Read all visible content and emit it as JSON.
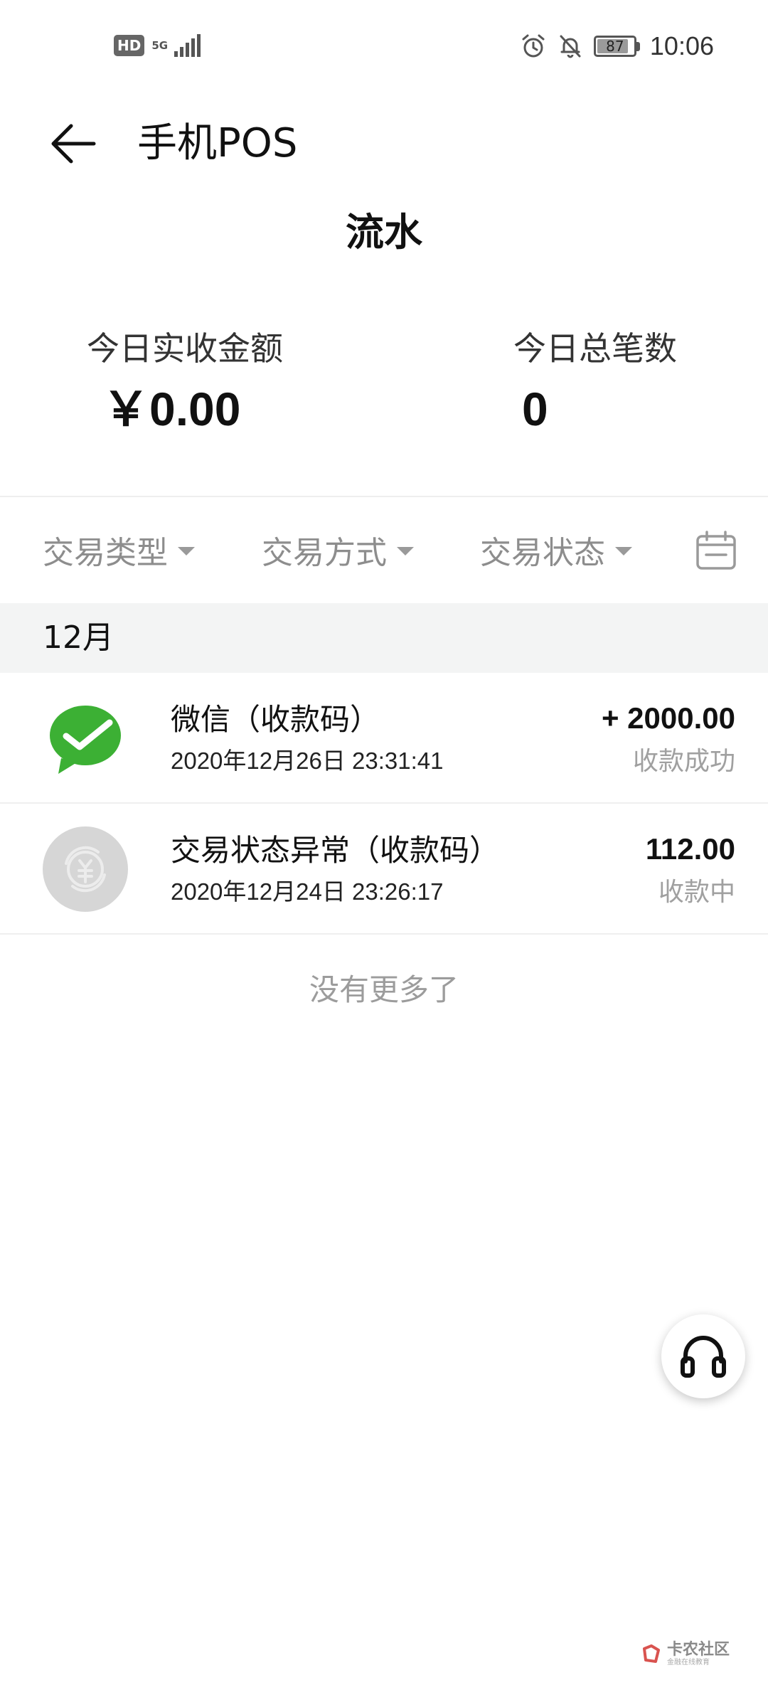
{
  "status_bar": {
    "hd": "HD",
    "network": "5G",
    "battery": "87",
    "battery_level": 0.87,
    "time": "10:06",
    "icons": [
      "alarm-icon",
      "mute-icon"
    ]
  },
  "app_bar": {
    "back_icon": "arrow-left-icon",
    "title": "手机POS"
  },
  "page": {
    "subtitle": "流水"
  },
  "summary": {
    "received_label": "今日实收金额",
    "received_value": "￥0.00",
    "count_label": "今日总笔数",
    "count_value": "0"
  },
  "filters": {
    "type": "交易类型",
    "method": "交易方式",
    "status": "交易状态",
    "calendar_icon": "calendar-icon"
  },
  "month": "12月",
  "transactions": [
    {
      "title": "微信（收款码）",
      "time": "2020年12月26日 23:31:41",
      "amount": "+ 2000.00",
      "status": "收款成功",
      "icon": "wechat-icon",
      "icon_color": "#3cb034"
    },
    {
      "title": "交易状态异常（收款码）",
      "time": "2020年12月24日 23:26:17",
      "amount": "112.00",
      "status": "收款中",
      "icon": "yuan-exchange-icon",
      "icon_color": "#d6d6d6"
    }
  ],
  "list_end": "没有更多了",
  "support_icon": "headset-icon",
  "watermark": {
    "title": "卡农社区",
    "subtitle": "金融在线教育"
  },
  "colors": {
    "text_primary": "#111111",
    "text_secondary": "#8d8d8d",
    "section_bg": "#f3f4f4",
    "wechat_green": "#3cb034"
  }
}
